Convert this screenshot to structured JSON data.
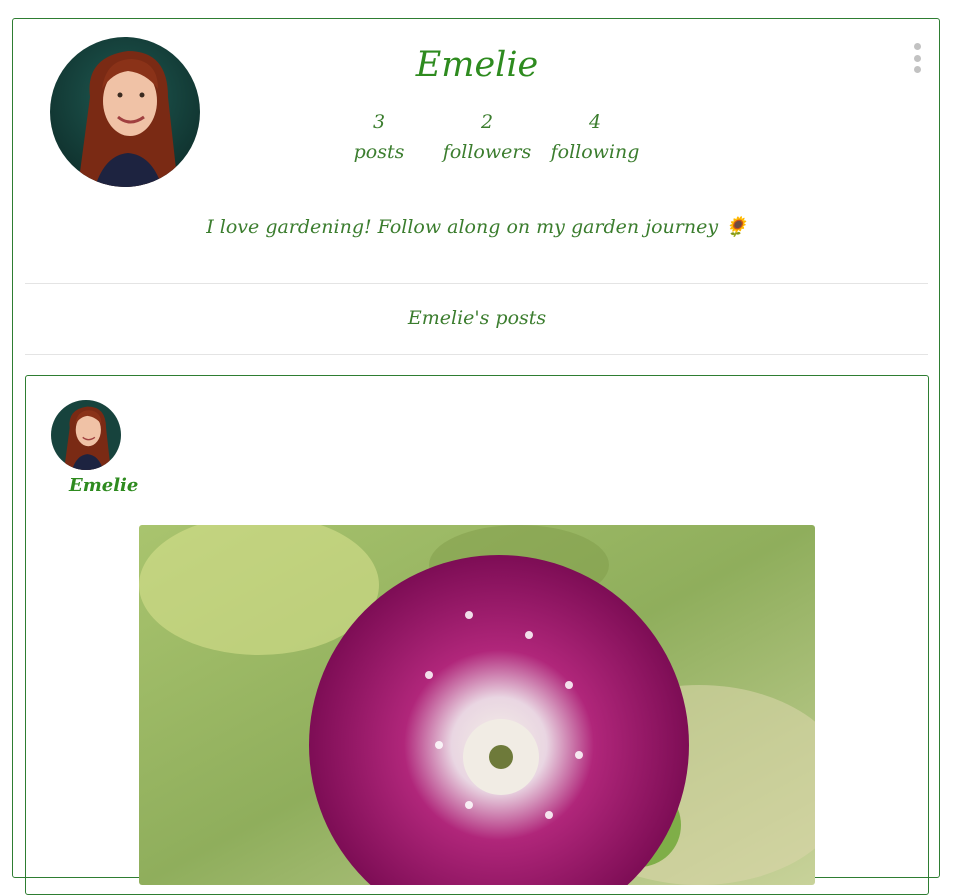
{
  "profile": {
    "name": "Emelie",
    "bio": "I love gardening! Follow along on my garden journey 🌻",
    "stats": [
      {
        "count": "3",
        "label": "posts"
      },
      {
        "count": "2",
        "label": "followers"
      },
      {
        "count": "4",
        "label": "following"
      }
    ]
  },
  "posts_section": {
    "heading": "Emelie's posts"
  },
  "posts": [
    {
      "author": "Emelie",
      "image": "dahlia-flower-photo"
    }
  ],
  "icons": {
    "menu": "more-vertical-icon"
  },
  "colors": {
    "accent": "#2e8b1f",
    "border": "#2e7d32",
    "menu_dots": "#c2c2c2"
  }
}
